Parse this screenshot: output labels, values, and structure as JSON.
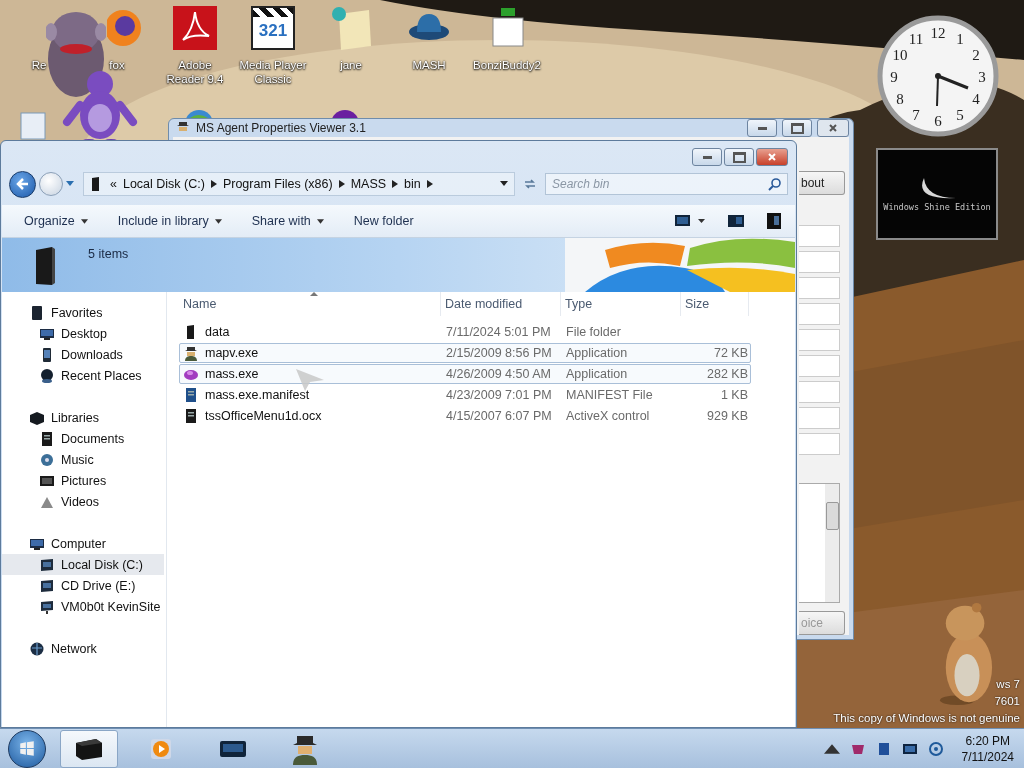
{
  "desktop_icons": [
    {
      "label": "Re",
      "kind": "hidden"
    },
    {
      "label": "fox",
      "kind": "fox"
    },
    {
      "label": "Adobe Reader 9.4",
      "kind": "pdf"
    },
    {
      "label": "Media Player Classic",
      "kind": "clapboard",
      "badge": "321"
    },
    {
      "label": "jane",
      "kind": "note"
    },
    {
      "label": "MASH",
      "kind": "hat"
    },
    {
      "label": "BonziBuddy2",
      "kind": "page"
    }
  ],
  "clock": {
    "numerals": [
      "12",
      "1",
      "2",
      "3",
      "4",
      "5",
      "6",
      "7",
      "8",
      "9",
      "10",
      "11"
    ]
  },
  "gadget": {
    "text": "Windows Shine Edition"
  },
  "background_window": {
    "title": "MS  Agent Properties Viewer 3.1",
    "top_button": "bout",
    "bottom_button": "oice"
  },
  "explorer": {
    "breadcrumb": {
      "overflow": "«",
      "parts": [
        "Local Disk (C:)",
        "Program Files (x86)",
        "MASS",
        "bin"
      ]
    },
    "search": {
      "placeholder": "Search bin"
    },
    "toolbar": [
      {
        "label": "Organize",
        "dropdown": true
      },
      {
        "label": "Include in library",
        "dropdown": true
      },
      {
        "label": "Share with",
        "dropdown": true
      },
      {
        "label": "New folder",
        "dropdown": false
      }
    ],
    "details": {
      "count": "5 items"
    },
    "nav": [
      {
        "label": "Favorites",
        "kind": "favorites",
        "selected": false,
        "children": [
          {
            "label": "Desktop",
            "kind": "desktop",
            "selected": false
          },
          {
            "label": "Downloads",
            "kind": "downloads",
            "selected": false
          },
          {
            "label": "Recent Places",
            "kind": "recent",
            "selected": false
          }
        ]
      },
      {
        "label": "Libraries",
        "kind": "libraries",
        "selected": false,
        "children": [
          {
            "label": "Documents",
            "kind": "documents",
            "selected": false
          },
          {
            "label": "Music",
            "kind": "music",
            "selected": false
          },
          {
            "label": "Pictures",
            "kind": "pictures",
            "selected": false
          },
          {
            "label": "Videos",
            "kind": "videos",
            "selected": false
          }
        ]
      },
      {
        "label": "Computer",
        "kind": "computer",
        "selected": false,
        "children": [
          {
            "label": "Local Disk (C:)",
            "kind": "drive",
            "selected": true
          },
          {
            "label": "CD Drive (E:)",
            "kind": "drive",
            "selected": false
          },
          {
            "label": "VM0b0t KevinSite",
            "kind": "netdrive",
            "selected": false
          }
        ]
      },
      {
        "label": "Network",
        "kind": "network",
        "selected": false
      }
    ],
    "columns": [
      {
        "label": "Name",
        "sorted": true
      },
      {
        "label": "Date modified",
        "sorted": false
      },
      {
        "label": "Type",
        "sorted": false
      },
      {
        "label": "Size",
        "sorted": false
      }
    ],
    "files": [
      {
        "name": "data",
        "date": "7/11/2024 5:01 PM",
        "type": "File folder",
        "kind": "folder",
        "selected": false
      },
      {
        "name": "mapv.exe",
        "date": "2/15/2009 8:56 PM",
        "type": "Application",
        "size": "72 KB",
        "kind": "spy",
        "selected": true
      },
      {
        "name": "mass.exe",
        "date": "4/26/2009 4:50 AM",
        "type": "Application",
        "size": "282 KB",
        "kind": "blob",
        "selected": true
      },
      {
        "name": "mass.exe.manifest",
        "date": "4/23/2009 7:01 PM",
        "type": "MANIFEST File",
        "size": "1 KB",
        "kind": "manifest",
        "selected": false
      },
      {
        "name": "tssOfficeMenu1d.ocx",
        "date": "4/15/2007 6:07 PM",
        "type": "ActiveX control",
        "size": "929 KB",
        "kind": "ocx",
        "selected": false
      }
    ]
  },
  "genuine_notice": {
    "lines": [
      "ws 7",
      "7601",
      "This copy of Windows is not genuine"
    ]
  },
  "taskbar": {
    "buttons": [
      {
        "kind": "explorer",
        "selected": true
      },
      {
        "kind": "media",
        "selected": false
      },
      {
        "kind": "screen",
        "selected": false
      },
      {
        "kind": "spy",
        "selected": false
      }
    ],
    "time": "6:20 PM",
    "date": "7/11/2024"
  }
}
